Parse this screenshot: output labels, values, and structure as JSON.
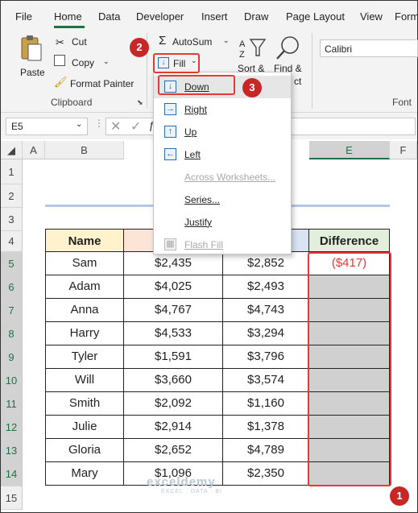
{
  "menubar": {
    "tabs": [
      "File",
      "Home",
      "Data",
      "Developer",
      "Insert",
      "Draw",
      "Page Layout",
      "View",
      "Form"
    ],
    "active": "Home"
  },
  "ribbon": {
    "paste": "Paste",
    "cut": "Cut",
    "copy": "Copy",
    "format_painter": "Format Painter",
    "clipboard_group": "Clipboard",
    "autosum": "AutoSum",
    "fill": "Fill",
    "sort_filter": "Sort &",
    "find_select": "Find &",
    "find_select_2": "ct",
    "font_name": "Calibri",
    "font_group": "Font"
  },
  "formula_bar": {
    "name_box": "E5",
    "fx": "f"
  },
  "fill_menu": {
    "items": [
      {
        "label": "Down",
        "icon": "arrow-down-icon",
        "enabled": true
      },
      {
        "label": "Right",
        "icon": "arrow-right-icon",
        "enabled": true
      },
      {
        "label": "Up",
        "icon": "arrow-up-icon",
        "enabled": true
      },
      {
        "label": "Left",
        "icon": "arrow-left-icon",
        "enabled": true
      },
      {
        "label": "Across Worksheets...",
        "icon": "",
        "enabled": false
      },
      {
        "label": "Series...",
        "icon": "",
        "enabled": true
      },
      {
        "label": "Justify",
        "icon": "",
        "enabled": true
      },
      {
        "label": "Flash Fill",
        "icon": "flash-fill-icon",
        "enabled": false
      }
    ]
  },
  "grid": {
    "columns": [
      "A",
      "B",
      "E",
      "F"
    ],
    "rows": [
      "1",
      "2",
      "3",
      "4",
      "5",
      "6",
      "7",
      "8",
      "9",
      "10",
      "11",
      "12",
      "13",
      "14",
      "15"
    ],
    "headers": {
      "name": "Name",
      "col_c_partial": "20",
      "col_d_partial": "s",
      "difference": "Difference"
    },
    "table": [
      {
        "name": "Sam",
        "c": "$2,435",
        "d": "$2,852",
        "diff": "($417)"
      },
      {
        "name": "Adam",
        "c": "$4,025",
        "d": "$2,493",
        "diff": ""
      },
      {
        "name": "Anna",
        "c": "$4,767",
        "d": "$4,743",
        "diff": ""
      },
      {
        "name": "Harry",
        "c": "$4,533",
        "d": "$3,294",
        "diff": ""
      },
      {
        "name": "Tyler",
        "c": "$1,591",
        "d": "$3,796",
        "diff": ""
      },
      {
        "name": "Will",
        "c": "$3,660",
        "d": "$3,574",
        "diff": ""
      },
      {
        "name": "Smith",
        "c": "$2,092",
        "d": "$1,160",
        "diff": ""
      },
      {
        "name": "Julie",
        "c": "$2,914",
        "d": "$1,378",
        "diff": ""
      },
      {
        "name": "Gloria",
        "c": "$2,652",
        "d": "$4,789",
        "diff": ""
      },
      {
        "name": "Mary",
        "c": "$1,096",
        "d": "$2,350",
        "diff": ""
      }
    ]
  },
  "callouts": [
    "1",
    "2",
    "3"
  ],
  "watermark": {
    "brand": "exceldemy",
    "tagline": "EXCEL · DATA · BI"
  },
  "colors": {
    "accent_green": "#1e7145",
    "name_header_bg": "#fff2cc",
    "col_c_header_bg": "#fce4d6",
    "col_d_header_bg": "#dae3f3",
    "difference_header_bg": "#e2efda",
    "selected_fill": "#d0d0d0",
    "negative_red": "#e53935",
    "callout_red": "#c62828"
  }
}
